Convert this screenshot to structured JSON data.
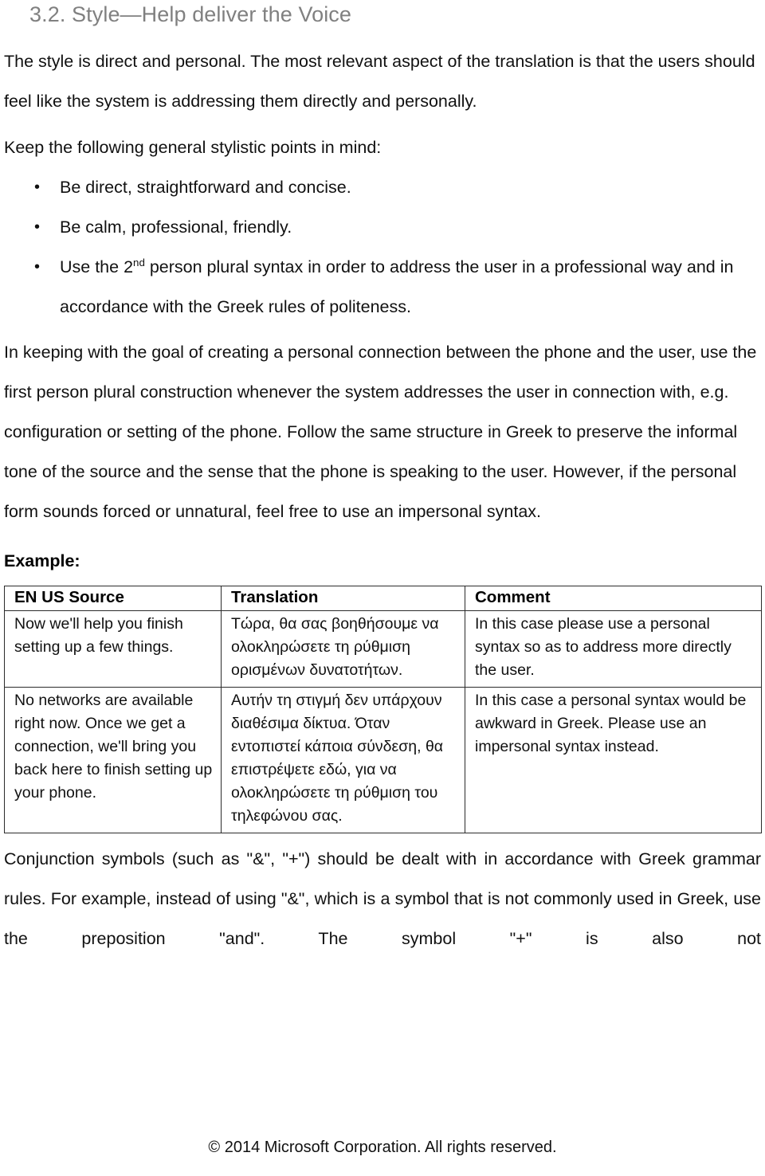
{
  "document": {
    "heading": "3.2. Style—Help deliver the Voice",
    "intro_paragraph": "The style is direct and personal. The most relevant aspect of the translation is that the users should feel like the system is addressing them directly and personally.",
    "keep_in_mind_lead": "Keep the following general stylistic points in mind:",
    "bullets": [
      {
        "marker": "•",
        "text": "Be direct, straightforward and concise."
      },
      {
        "marker": "•",
        "text": "Be calm, professional, friendly."
      },
      {
        "marker": "•",
        "text_before_sup": "Use the 2",
        "sup": "nd",
        "text_after_sup": " person plural syntax in order to address the user in a professional way and in accordance with the Greek rules of politeness."
      }
    ],
    "personal_connection_paragraph": "In keeping with the goal of creating a personal connection between the phone and the user, use the first person plural construction whenever the system addresses the user in connection with, e.g. configuration or setting of the phone. Follow the same structure in Greek to preserve the informal tone of the source and the sense that the phone is speaking to the user. However, if the personal form sounds forced or unnatural, feel free to use an impersonal syntax.",
    "example_label": "Example:",
    "conjunction_paragraph_main": "Conjunction symbols (such as \"&\", \"+\") should be dealt with in accordance with Greek grammar rules. For example, instead of using \"&\", which is a symbol that is not commonly used in Greek, use the preposition \"and\". The symbol \"+\" is also not",
    "footer": "© 2014 Microsoft Corporation.  All rights reserved."
  },
  "example_table": {
    "headers": [
      "EN US Source",
      "Translation",
      "Comment"
    ],
    "rows": [
      {
        "source": "Now we'll help you finish setting up a few things.",
        "translation": "Τώρα, θα σας βοηθήσουμε να ολοκληρώσετε τη ρύθμιση ορισμένων δυνατοτήτων.",
        "comment": "In this case please use a personal syntax so as to address more directly the user."
      },
      {
        "source": "No networks are available right now. Once we get a connection, we'll bring you back here to finish setting up your phone.",
        "translation": "Αυτήν τη στιγμή δεν υπάρχουν διαθέσιμα δίκτυα. Όταν εντοπιστεί κάποια σύνδεση, θα επιστρέψετε εδώ, για να ολοκληρώσετε τη ρύθμιση του τηλεφώνου σας.",
        "comment": "In this case a personal syntax would be awkward in Greek. Please use an impersonal syntax instead."
      }
    ]
  },
  "colors": {
    "heading": "#808080",
    "body_text": "#111111",
    "table_border": "#2b2b2b",
    "page_background": "#ffffff"
  }
}
